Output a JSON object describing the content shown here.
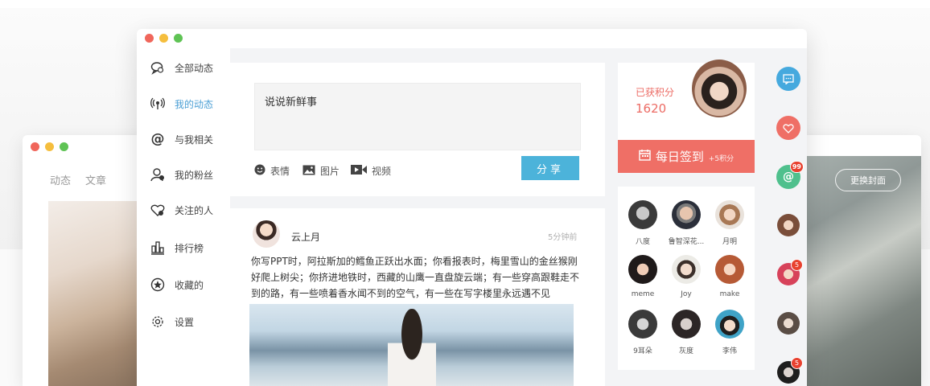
{
  "colors": {
    "close": "#f0665b",
    "minimize": "#f5be3e",
    "zoom": "#5fc354",
    "accent_blue": "#4cb3da",
    "accent_red": "#ef6f66"
  },
  "back_window": {
    "nav": [
      "动态",
      "文章"
    ],
    "cover_button": "更换封面"
  },
  "sidebar": {
    "items": [
      {
        "icon": "chat-bubbles-icon",
        "label": "全部动态",
        "active": false
      },
      {
        "icon": "broadcast-icon",
        "label": "我的动态",
        "active": true
      },
      {
        "icon": "at-sign-icon",
        "label": "与我相关",
        "active": false
      },
      {
        "icon": "fans-icon",
        "label": "我的粉丝",
        "active": false
      },
      {
        "icon": "heart-user-icon",
        "label": "关注的人",
        "active": false
      },
      {
        "icon": "ranking-icon",
        "label": "排行榜",
        "active": false
      },
      {
        "icon": "star-circle-icon",
        "label": "收藏的",
        "active": false
      },
      {
        "icon": "settings-gear-icon",
        "label": "设置",
        "active": false
      }
    ]
  },
  "composer": {
    "placeholder": "说说新鲜事",
    "tools": [
      {
        "icon": "smiley-icon",
        "label": "表情"
      },
      {
        "icon": "image-icon",
        "label": "图片"
      },
      {
        "icon": "video-icon",
        "label": "视频"
      }
    ],
    "share_label": "分享"
  },
  "post": {
    "user": "云上月",
    "time": "5分钟前",
    "text": "你写PPT时，阿拉斯加的鳕鱼正跃出水面；你看报表时，梅里雪山的金丝猴刚好爬上树尖；你挤进地铁时，西藏的山鹰一直盘旋云端；有一些穿高跟鞋走不到的路，有一些喷着香水闻不到的空气，有一些在写字楼里永远遇不见"
  },
  "points": {
    "label": "已获积分",
    "value": "1620",
    "signin_label": "每日签到",
    "signin_bonus": "+5积分"
  },
  "friends": [
    {
      "name": "八度"
    },
    {
      "name": "鲁智深花..."
    },
    {
      "name": "月明"
    },
    {
      "name": "meme"
    },
    {
      "name": "Joy"
    },
    {
      "name": "make"
    },
    {
      "name": "9耳朵"
    },
    {
      "name": "灰度"
    },
    {
      "name": "李伟"
    }
  ],
  "rail": {
    "message_icon": "message-icon",
    "heart_icon": "heart-icon",
    "mention_icon": "at-sign-icon",
    "mention_badge": "99",
    "avatar_badges": [
      "5",
      "5"
    ]
  }
}
